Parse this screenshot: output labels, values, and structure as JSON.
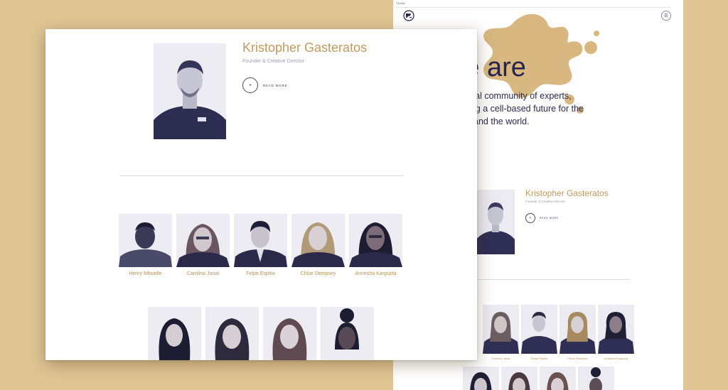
{
  "colors": {
    "background": "#e0c694",
    "accent_gold": "#c29a5e",
    "heading_navy": "#242451",
    "photo_tint": "#3b3b63"
  },
  "back": {
    "nav_label": "TEAM",
    "logo_icon": "globe-logo-icon",
    "menu_icon_label": "☰",
    "heading": "ho we are",
    "intro_lines": [
      "s together a global community of experts,",
      "e about cultivating a cell-based future for the",
      "people, animals and the world."
    ],
    "featured": {
      "name": "Kristopher Gasteratos",
      "role": "Founder & Creative Director",
      "read_more_icon": "+",
      "read_more_label": "READ MORE"
    },
    "team": [
      {
        "name": "Carolina Janat"
      },
      {
        "name": "Felipe Espitia"
      },
      {
        "name": "Chloe Dempsey"
      },
      {
        "name": "Annesha Kargupta"
      }
    ]
  },
  "front": {
    "featured": {
      "name": "Kristopher Gasteratos",
      "role": "Founder & Creative Director",
      "read_more_icon": "+",
      "read_more_label": "READ MORE"
    },
    "team_row1": [
      {
        "name": "Henry Mbwelle"
      },
      {
        "name": "Carolina Janat"
      },
      {
        "name": "Felpe Espitia"
      },
      {
        "name": "Chloe Dempsey"
      },
      {
        "name": "Annesha Kargupta"
      }
    ]
  }
}
